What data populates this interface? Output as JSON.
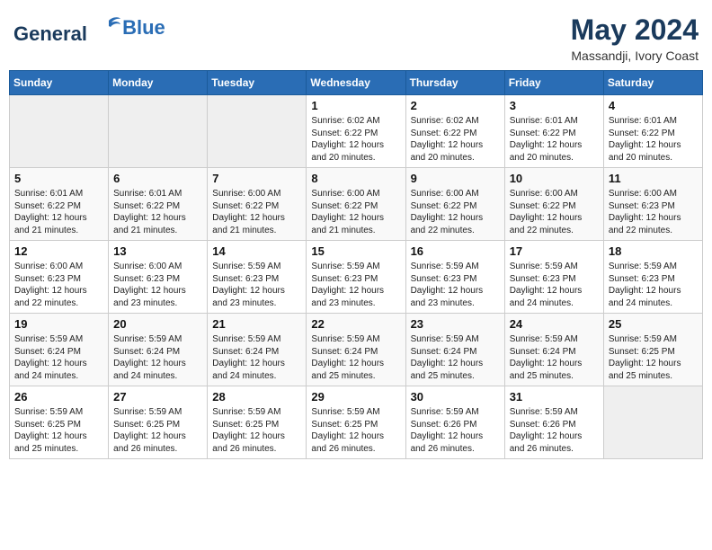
{
  "header": {
    "logo_line1": "General",
    "logo_line2": "Blue",
    "main_title": "May 2024",
    "sub_title": "Massandji, Ivory Coast"
  },
  "weekdays": [
    "Sunday",
    "Monday",
    "Tuesday",
    "Wednesday",
    "Thursday",
    "Friday",
    "Saturday"
  ],
  "weeks": [
    [
      {
        "day": "",
        "info": ""
      },
      {
        "day": "",
        "info": ""
      },
      {
        "day": "",
        "info": ""
      },
      {
        "day": "1",
        "info": "Sunrise: 6:02 AM\nSunset: 6:22 PM\nDaylight: 12 hours\nand 20 minutes."
      },
      {
        "day": "2",
        "info": "Sunrise: 6:02 AM\nSunset: 6:22 PM\nDaylight: 12 hours\nand 20 minutes."
      },
      {
        "day": "3",
        "info": "Sunrise: 6:01 AM\nSunset: 6:22 PM\nDaylight: 12 hours\nand 20 minutes."
      },
      {
        "day": "4",
        "info": "Sunrise: 6:01 AM\nSunset: 6:22 PM\nDaylight: 12 hours\nand 20 minutes."
      }
    ],
    [
      {
        "day": "5",
        "info": "Sunrise: 6:01 AM\nSunset: 6:22 PM\nDaylight: 12 hours\nand 21 minutes."
      },
      {
        "day": "6",
        "info": "Sunrise: 6:01 AM\nSunset: 6:22 PM\nDaylight: 12 hours\nand 21 minutes."
      },
      {
        "day": "7",
        "info": "Sunrise: 6:00 AM\nSunset: 6:22 PM\nDaylight: 12 hours\nand 21 minutes."
      },
      {
        "day": "8",
        "info": "Sunrise: 6:00 AM\nSunset: 6:22 PM\nDaylight: 12 hours\nand 21 minutes."
      },
      {
        "day": "9",
        "info": "Sunrise: 6:00 AM\nSunset: 6:22 PM\nDaylight: 12 hours\nand 22 minutes."
      },
      {
        "day": "10",
        "info": "Sunrise: 6:00 AM\nSunset: 6:22 PM\nDaylight: 12 hours\nand 22 minutes."
      },
      {
        "day": "11",
        "info": "Sunrise: 6:00 AM\nSunset: 6:23 PM\nDaylight: 12 hours\nand 22 minutes."
      }
    ],
    [
      {
        "day": "12",
        "info": "Sunrise: 6:00 AM\nSunset: 6:23 PM\nDaylight: 12 hours\nand 22 minutes."
      },
      {
        "day": "13",
        "info": "Sunrise: 6:00 AM\nSunset: 6:23 PM\nDaylight: 12 hours\nand 23 minutes."
      },
      {
        "day": "14",
        "info": "Sunrise: 5:59 AM\nSunset: 6:23 PM\nDaylight: 12 hours\nand 23 minutes."
      },
      {
        "day": "15",
        "info": "Sunrise: 5:59 AM\nSunset: 6:23 PM\nDaylight: 12 hours\nand 23 minutes."
      },
      {
        "day": "16",
        "info": "Sunrise: 5:59 AM\nSunset: 6:23 PM\nDaylight: 12 hours\nand 23 minutes."
      },
      {
        "day": "17",
        "info": "Sunrise: 5:59 AM\nSunset: 6:23 PM\nDaylight: 12 hours\nand 24 minutes."
      },
      {
        "day": "18",
        "info": "Sunrise: 5:59 AM\nSunset: 6:23 PM\nDaylight: 12 hours\nand 24 minutes."
      }
    ],
    [
      {
        "day": "19",
        "info": "Sunrise: 5:59 AM\nSunset: 6:24 PM\nDaylight: 12 hours\nand 24 minutes."
      },
      {
        "day": "20",
        "info": "Sunrise: 5:59 AM\nSunset: 6:24 PM\nDaylight: 12 hours\nand 24 minutes."
      },
      {
        "day": "21",
        "info": "Sunrise: 5:59 AM\nSunset: 6:24 PM\nDaylight: 12 hours\nand 24 minutes."
      },
      {
        "day": "22",
        "info": "Sunrise: 5:59 AM\nSunset: 6:24 PM\nDaylight: 12 hours\nand 25 minutes."
      },
      {
        "day": "23",
        "info": "Sunrise: 5:59 AM\nSunset: 6:24 PM\nDaylight: 12 hours\nand 25 minutes."
      },
      {
        "day": "24",
        "info": "Sunrise: 5:59 AM\nSunset: 6:24 PM\nDaylight: 12 hours\nand 25 minutes."
      },
      {
        "day": "25",
        "info": "Sunrise: 5:59 AM\nSunset: 6:25 PM\nDaylight: 12 hours\nand 25 minutes."
      }
    ],
    [
      {
        "day": "26",
        "info": "Sunrise: 5:59 AM\nSunset: 6:25 PM\nDaylight: 12 hours\nand 25 minutes."
      },
      {
        "day": "27",
        "info": "Sunrise: 5:59 AM\nSunset: 6:25 PM\nDaylight: 12 hours\nand 26 minutes."
      },
      {
        "day": "28",
        "info": "Sunrise: 5:59 AM\nSunset: 6:25 PM\nDaylight: 12 hours\nand 26 minutes."
      },
      {
        "day": "29",
        "info": "Sunrise: 5:59 AM\nSunset: 6:25 PM\nDaylight: 12 hours\nand 26 minutes."
      },
      {
        "day": "30",
        "info": "Sunrise: 5:59 AM\nSunset: 6:26 PM\nDaylight: 12 hours\nand 26 minutes."
      },
      {
        "day": "31",
        "info": "Sunrise: 5:59 AM\nSunset: 6:26 PM\nDaylight: 12 hours\nand 26 minutes."
      },
      {
        "day": "",
        "info": ""
      }
    ]
  ]
}
